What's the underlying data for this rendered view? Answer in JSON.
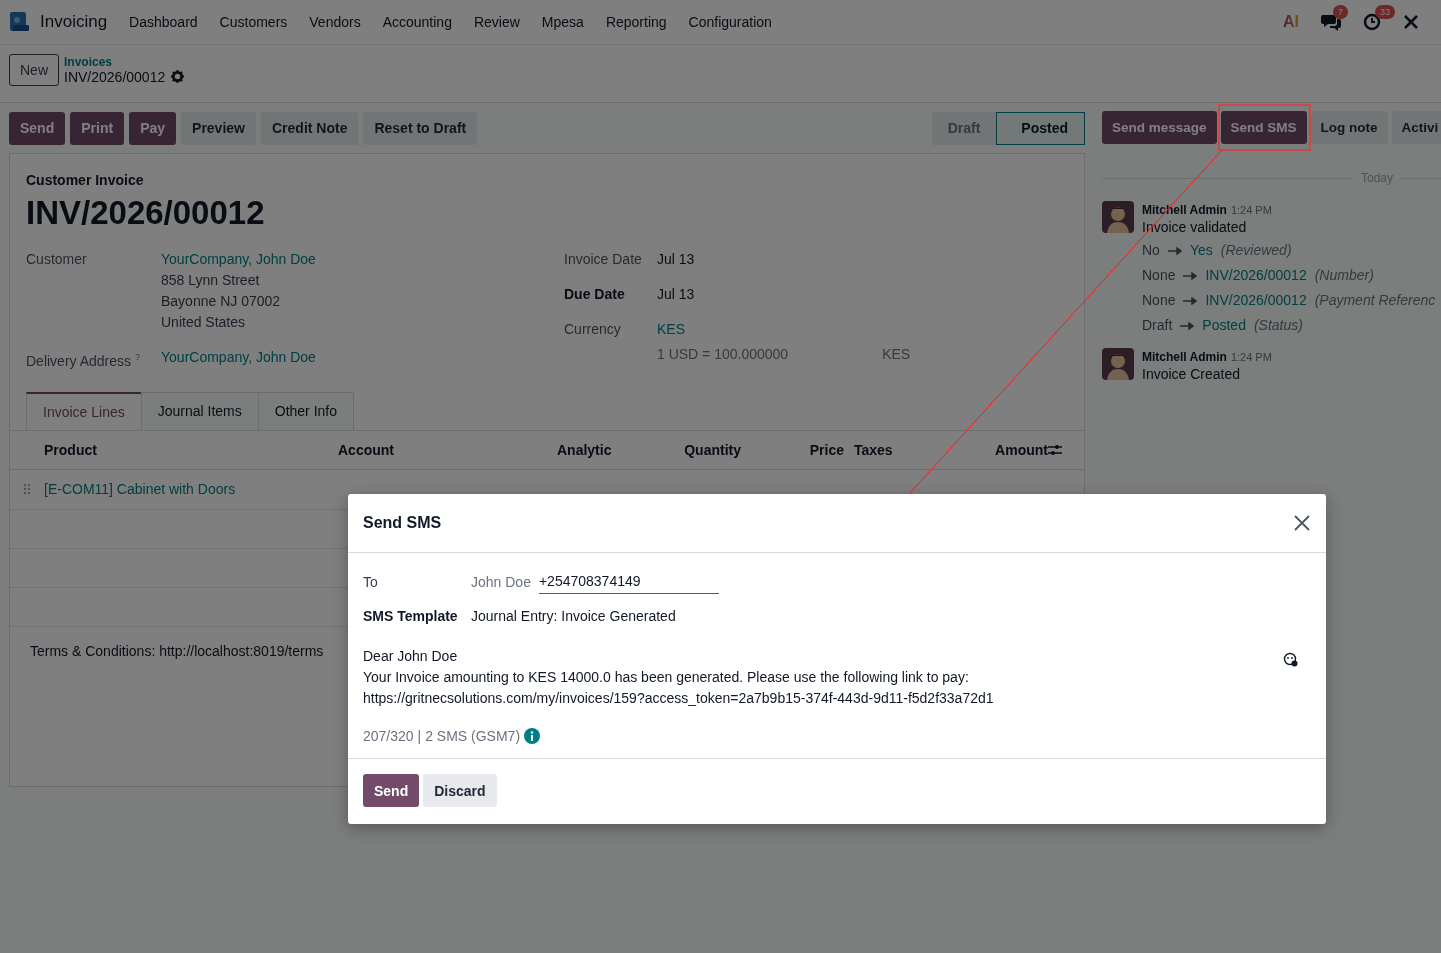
{
  "navbar": {
    "app_name": "Invoicing",
    "menu": [
      "Dashboard",
      "Customers",
      "Vendors",
      "Accounting",
      "Review",
      "Mpesa",
      "Reporting",
      "Configuration"
    ],
    "ai_label": "AI",
    "message_count": "7",
    "activity_count": "33"
  },
  "control_panel": {
    "new_button": "New",
    "breadcrumb": "Invoices",
    "record_name": "INV/2026/00012"
  },
  "actions": [
    {
      "label": "Send",
      "kind": "primary"
    },
    {
      "label": "Print",
      "kind": "primary"
    },
    {
      "label": "Pay",
      "kind": "primary"
    },
    {
      "label": "Preview",
      "kind": "secondary"
    },
    {
      "label": "Credit Note",
      "kind": "secondary"
    },
    {
      "label": "Reset to Draft",
      "kind": "secondary"
    }
  ],
  "status_bar": [
    {
      "label": "Draft",
      "selected": false
    },
    {
      "label": "Posted",
      "selected": true
    }
  ],
  "sheet": {
    "subtitle": "Customer Invoice",
    "title": "INV/2026/00012",
    "customer": {
      "label": "Customer",
      "name": "YourCompany, John Doe",
      "address": [
        "858 Lynn Street",
        "Bayonne NJ 07002",
        "United States"
      ]
    },
    "delivery": {
      "label": "Delivery Address",
      "help": "?",
      "name": "YourCompany, John Doe"
    },
    "invoice_date": {
      "label": "Invoice Date",
      "value": "Jul 13"
    },
    "due_date": {
      "label": "Due Date",
      "value": "Jul 13"
    },
    "currency": {
      "label": "Currency",
      "value": "KES",
      "rate": "1 USD = 100.000000",
      "rate_currency": "KES"
    },
    "tabs": [
      {
        "label": "Invoice Lines",
        "selected": true
      },
      {
        "label": "Journal Items",
        "selected": false
      },
      {
        "label": "Other Info",
        "selected": false
      }
    ],
    "columns": [
      "Product",
      "Account",
      "Analytic",
      "Quantity",
      "Price",
      "Taxes",
      "Amount"
    ],
    "rows": [
      {
        "product": "[E-COM11] Cabinet with Doors"
      }
    ],
    "terms": "Terms & Conditions: http://localhost:8019/terms"
  },
  "chatter": {
    "buttons": [
      {
        "label": "Send message",
        "kind": "primary"
      },
      {
        "label": "Send SMS",
        "kind": "primary"
      },
      {
        "label": "Log note",
        "kind": "secondary"
      },
      {
        "label": "Activi",
        "kind": "secondary"
      }
    ],
    "date_separator": "Today",
    "messages": [
      {
        "author": "Mitchell Admin",
        "time": "1:24 PM",
        "body": "Invoice validated",
        "changes": [
          {
            "old": "No",
            "new": "Yes",
            "field": "(Reviewed)"
          },
          {
            "old": "None",
            "new": "INV/2026/00012",
            "field": "(Number)"
          },
          {
            "old": "None",
            "new": "INV/2026/00012",
            "field": "(Payment Referenc"
          },
          {
            "old": "Draft",
            "new": "Posted",
            "field": "(Status)"
          }
        ]
      },
      {
        "author": "Mitchell Admin",
        "time": "1:24 PM",
        "body": "Invoice Created"
      }
    ]
  },
  "dialog": {
    "title": "Send SMS",
    "to_label": "To",
    "recipient": "John Doe",
    "phone": "+254708374149",
    "template_label": "SMS Template",
    "template": "Journal Entry: Invoice Generated",
    "body": "Dear John Doe\nYour Invoice amounting to KES 14000.0 has been generated. Please use the following link to pay:\nhttps://gritnecsolutions.com/my/invoices/159?access_token=2a7b9b15-374f-443d-9d11-f5d2f33a72d1",
    "counter": "207/320",
    "sms_info": "| 2 SMS (GSM7)",
    "buttons": [
      {
        "label": "Send",
        "kind": "primary"
      },
      {
        "label": "Discard",
        "kind": "secondary"
      }
    ]
  }
}
